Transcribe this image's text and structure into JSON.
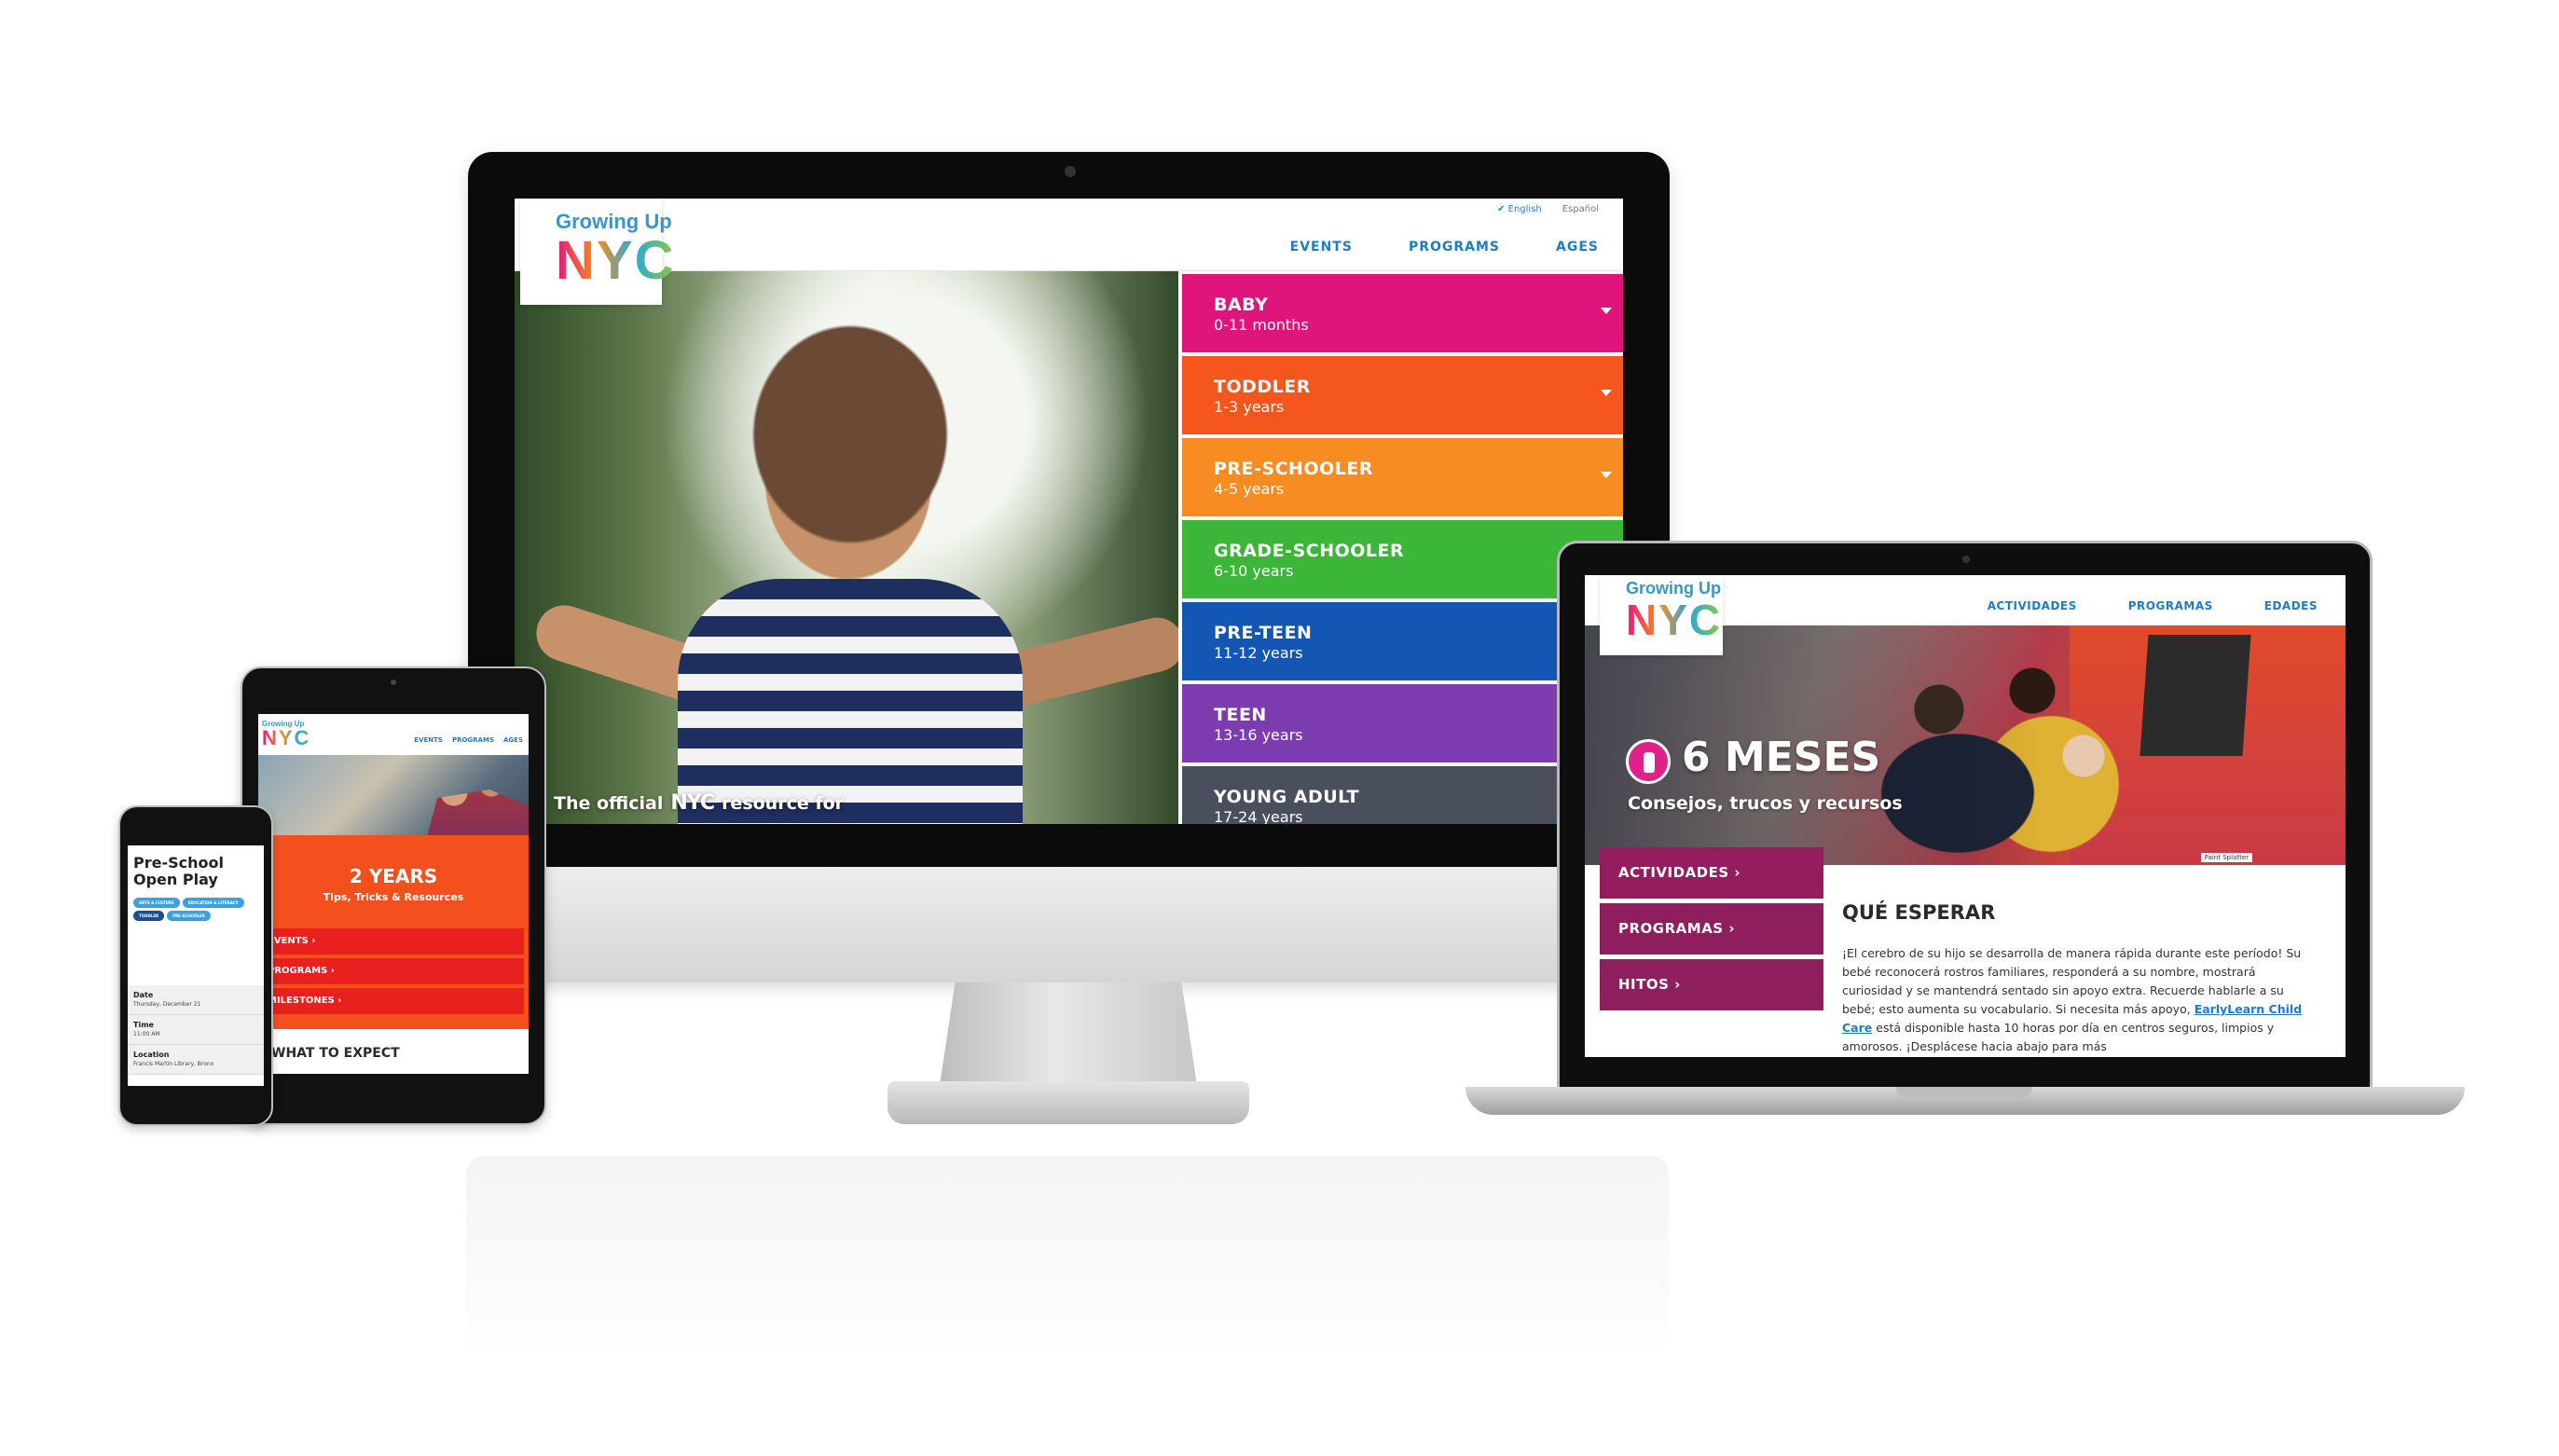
{
  "logo": {
    "top": "Growing Up",
    "mark": "NYC"
  },
  "desktop": {
    "lang": {
      "english": "✔ English",
      "spanish": "Español"
    },
    "nav": [
      "EVENTS",
      "PROGRAMS",
      "AGES"
    ],
    "tagline": {
      "pre": "The official",
      "mark": "NYC",
      "post": "resource for"
    },
    "ages": [
      {
        "name": "BABY",
        "range": "0-11 months",
        "color": "#e0157c",
        "chevron": true
      },
      {
        "name": "TODDLER",
        "range": "1-3 years",
        "color": "#f4561e",
        "chevron": true
      },
      {
        "name": "PRE-SCHOOLER",
        "range": "4-5 years",
        "color": "#f78c22",
        "chevron": true
      },
      {
        "name": "GRADE-SCHOOLER",
        "range": "6-10 years",
        "color": "#3cb638",
        "chevron": false
      },
      {
        "name": "PRE-TEEN",
        "range": "11-12 years",
        "color": "#1456b4",
        "chevron": false
      },
      {
        "name": "TEEN",
        "range": "13-16 years",
        "color": "#7d3bb0",
        "chevron": false
      },
      {
        "name": "YOUNG ADULT",
        "range": "17-24 years",
        "color": "#4a4f5e",
        "chevron": false
      }
    ]
  },
  "tablet": {
    "nav": [
      "EVENTS",
      "PROGRAMS",
      "AGES"
    ],
    "age": "2 YEARS",
    "subtitle": "Tips, Tricks & Resources",
    "links": [
      "EVENTS ›",
      "PROGRAMS ›",
      "MILESTONES ›"
    ],
    "section": "WHAT TO EXPECT"
  },
  "phone": {
    "title": "Pre-School Open Play",
    "tags": [
      "ARTS & CULTURE",
      "EDUCATION & LITERACY",
      "TODDLER",
      "PRE-SCHOOLER"
    ],
    "rows": [
      {
        "label": "Date",
        "value": "Thursday, December 21"
      },
      {
        "label": "Time",
        "value": "11:00 AM"
      },
      {
        "label": "Location",
        "value": "Francis Martin Library, Bronx"
      }
    ]
  },
  "laptop": {
    "nav": [
      "ACTIVIDADES",
      "PROGRAMAS",
      "EDADES"
    ],
    "age": "6 MESES",
    "subtitle": "Consejos, trucos y recursos",
    "credit": "Paint Splatter",
    "menu": [
      "ACTIVIDADES ›",
      "PROGRAMAS ›",
      "HITOS ›"
    ],
    "section": "QUÉ ESPERAR",
    "body_pre": "¡El cerebro de su hijo se desarrolla de manera rápida durante este período! Su bebé reconocerá rostros familiares, responderá a su nombre, mostrará curiosidad y se mantendrá sentado sin apoyo extra. Recuerde hablarle a su bebé; esto aumenta su vocabulario. Si necesita más apoyo,",
    "body_link": "EarlyLearn Child Care",
    "body_post": "está disponible hasta 10 horas por día en centros seguros, limpios y amorosos. ¡Desplácese hacia abajo para más"
  }
}
